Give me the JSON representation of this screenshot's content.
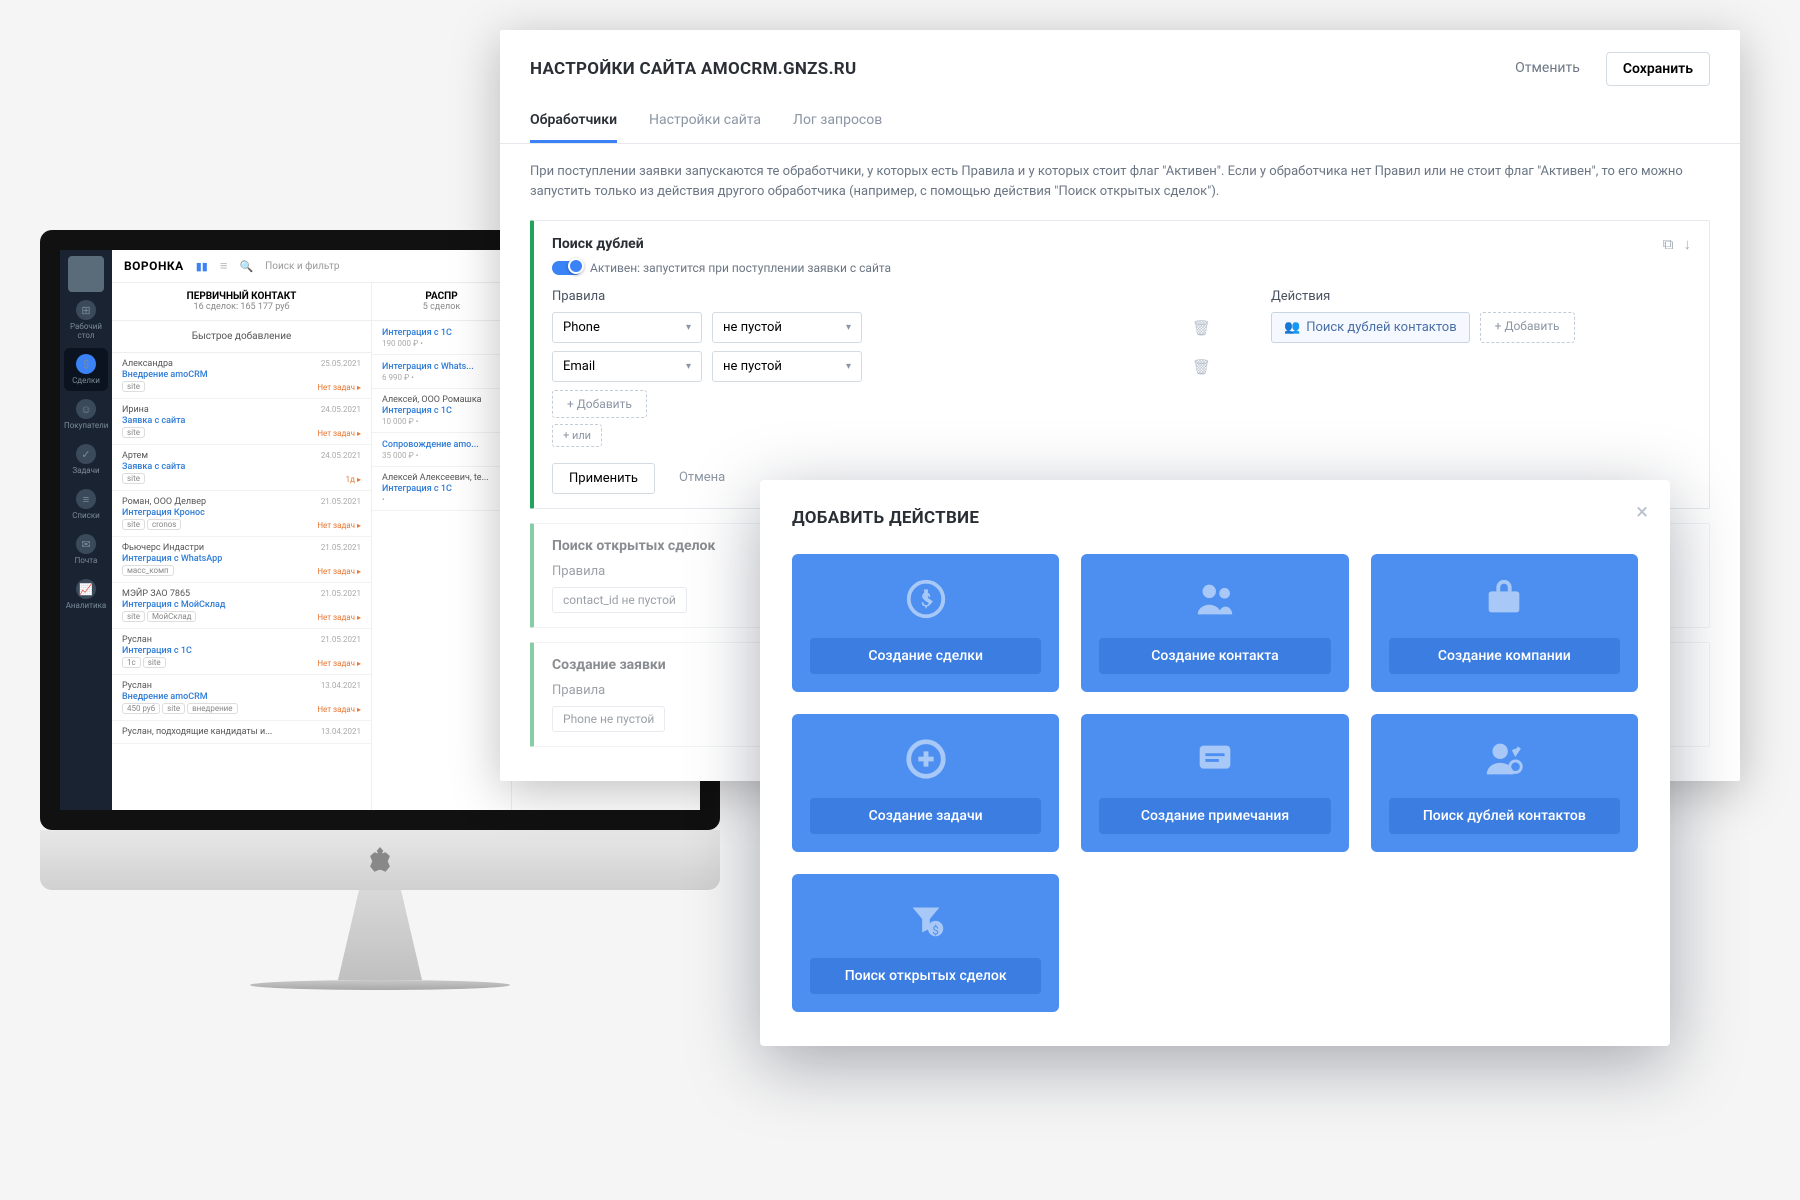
{
  "crm": {
    "title": "ВОРОНКА",
    "search_placeholder": "Поиск и фильтр",
    "nav": [
      {
        "label": "Рабочий стол"
      },
      {
        "label": "Сделки"
      },
      {
        "label": "Покупатели"
      },
      {
        "label": "Задачи"
      },
      {
        "label": "Списки"
      },
      {
        "label": "Почта"
      },
      {
        "label": "Аналитика"
      }
    ],
    "col1": {
      "title": "ПЕРВИЧНЫЙ КОНТАКТ",
      "sub": "16 сделок: 165 177 руб",
      "quick": "Быстрое добавление",
      "cards": [
        {
          "name": "Александра",
          "link": "Внедрение amoCRM",
          "date": "25.05.2021",
          "tags": [
            "site"
          ],
          "status": "Нет задач"
        },
        {
          "name": "Ирина",
          "link": "Заявка с сайта",
          "date": "24.05.2021",
          "tags": [
            "site"
          ],
          "status": "Нет задач"
        },
        {
          "name": "Артем",
          "link": "Заявка с сайта",
          "date": "24.05.2021",
          "tags": [
            "site"
          ],
          "status": "1д"
        },
        {
          "name": "Роман, ООО Делвер",
          "link": "Интеграция Кронос",
          "date": "21.05.2021",
          "tags": [
            "site",
            "cronos"
          ],
          "status": "Нет задач"
        },
        {
          "name": "Фьючерс Индастри",
          "link": "Интеграция с WhatsApp",
          "date": "21.05.2021",
          "tags": [
            "масс_комп"
          ],
          "status": "Нет задач"
        },
        {
          "name": "МЭЙР ЗАО 7865",
          "link": "Интеграция с МойСклад",
          "date": "21.05.2021",
          "tags": [
            "site",
            "МойСклад"
          ],
          "status": "Нет задач"
        },
        {
          "name": "Руслан",
          "link": "Интеграция с 1С",
          "date": "21.05.2021",
          "tags": [
            "1c",
            "site"
          ],
          "status": "Нет задач"
        },
        {
          "name": "Руслан",
          "link": "Внедрение amoCRM",
          "date": "13.04.2021",
          "tags": [
            "450 руб",
            "site",
            "внедрение"
          ],
          "status": "Нет задач"
        },
        {
          "name": "Руслан, подходящие кандидаты и...",
          "link": "",
          "date": "13.04.2021",
          "tags": [],
          "status": ""
        }
      ]
    },
    "col2": {
      "title": "РАСПР",
      "sub": "5 сделок",
      "cards": [
        {
          "link": "Интеграция с 1С",
          "price": "190 000 ₽"
        },
        {
          "link": "Интеграция с Whats...",
          "price": "6 990 ₽"
        },
        {
          "name": "Алексей, ООО Ромашка",
          "link": "Интеграция с 1С",
          "price": "10 000 ₽"
        },
        {
          "link": "Сопровождение amo...",
          "price": "35 000 ₽"
        },
        {
          "name": "Алексей Алексеевич, te...",
          "link": "Интеграция с 1С",
          "price": ""
        }
      ]
    }
  },
  "settings": {
    "title": "НАСТРОЙКИ САЙТА AMOCRM.GNZS.RU",
    "cancel": "Отменить",
    "save": "Сохранить",
    "tabs": [
      "Обработчики",
      "Настройки сайта",
      "Лог запросов"
    ],
    "description": "При поступлении заявки запускаются те обработчики, у которых есть Правила и у которых стоит флаг \"Активен\". Если у обработчика нет Правил или не стоит флаг \"Активен\", то его можно запустить только из действия другого обработчика (например, с помощью действия \"Поиск открытых сделок\").",
    "handler1": {
      "title": "Поиск дублей",
      "toggle_label": "Активен: запустится при поступлении заявки с сайта",
      "rules_label": "Правила",
      "actions_label": "Действия",
      "rule1_field": "Phone",
      "rule1_op": "не пустой",
      "rule2_field": "Email",
      "rule2_op": "не пустой",
      "add": "+ Добавить",
      "or": "+ или",
      "action_chip": "Поиск дублей контактов",
      "action_add": "+ Добавить",
      "apply": "Применить",
      "cancel": "Отмена"
    },
    "handler2": {
      "title": "Поиск открытых сделок",
      "rules_label": "Правила",
      "rule": "contact_id не пустой"
    },
    "handler3": {
      "title": "Создание заявки",
      "rules_label": "Правила",
      "rule": "Phone не пустой"
    }
  },
  "modal": {
    "title": "ДОБАВИТЬ ДЕЙСТВИЕ",
    "cards": [
      "Создание сделки",
      "Создание контакта",
      "Создание компании",
      "Создание задачи",
      "Создание примечания",
      "Поиск дублей контактов",
      "Поиск открытых сделок"
    ]
  }
}
